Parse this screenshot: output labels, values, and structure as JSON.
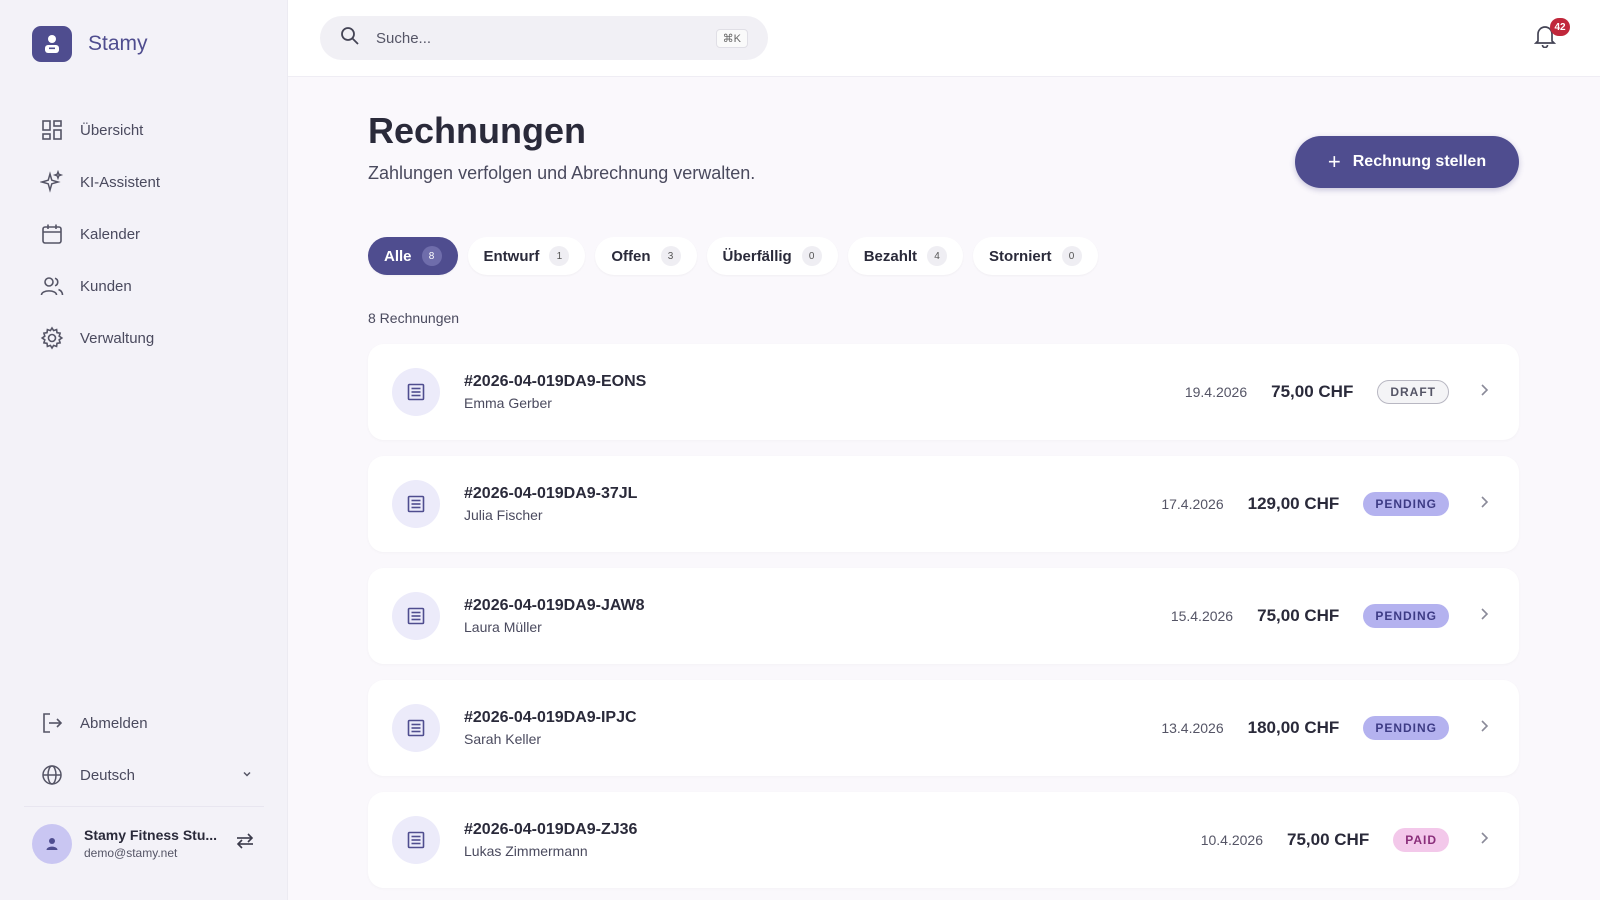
{
  "app": {
    "name": "Stamy"
  },
  "sidebar": {
    "items": [
      {
        "label": "Übersicht",
        "icon": "dashboard-icon"
      },
      {
        "label": "KI-Assistent",
        "icon": "sparkles-icon"
      },
      {
        "label": "Kalender",
        "icon": "calendar-icon"
      },
      {
        "label": "Kunden",
        "icon": "users-icon"
      },
      {
        "label": "Verwaltung",
        "icon": "gear-icon"
      }
    ],
    "logout_label": "Abmelden",
    "language_label": "Deutsch",
    "user": {
      "name": "Stamy Fitness Stu...",
      "email": "demo@stamy.net"
    }
  },
  "topbar": {
    "search_placeholder": "Suche...",
    "shortcut": "⌘K",
    "notification_count": "42"
  },
  "page": {
    "title": "Rechnungen",
    "subtitle": "Zahlungen verfolgen und Abrechnung verwalten.",
    "primary_button": "Rechnung stellen",
    "count_text": "8 Rechnungen"
  },
  "tabs": [
    {
      "label": "Alle",
      "count": "8",
      "active": true
    },
    {
      "label": "Entwurf",
      "count": "1"
    },
    {
      "label": "Offen",
      "count": "3"
    },
    {
      "label": "Überfällig",
      "count": "0"
    },
    {
      "label": "Bezahlt",
      "count": "4"
    },
    {
      "label": "Storniert",
      "count": "0"
    }
  ],
  "invoices": [
    {
      "id": "#2026-04-019DA9-EONS",
      "customer": "Emma Gerber",
      "date": "19.4.2026",
      "amount": "75,00 CHF",
      "status": "DRAFT"
    },
    {
      "id": "#2026-04-019DA9-37JL",
      "customer": "Julia Fischer",
      "date": "17.4.2026",
      "amount": "129,00 CHF",
      "status": "PENDING"
    },
    {
      "id": "#2026-04-019DA9-JAW8",
      "customer": "Laura Müller",
      "date": "15.4.2026",
      "amount": "75,00 CHF",
      "status": "PENDING"
    },
    {
      "id": "#2026-04-019DA9-IPJC",
      "customer": "Sarah Keller",
      "date": "13.4.2026",
      "amount": "180,00 CHF",
      "status": "PENDING"
    },
    {
      "id": "#2026-04-019DA9-ZJ36",
      "customer": "Lukas Zimmermann",
      "date": "10.4.2026",
      "amount": "75,00 CHF",
      "status": "PAID"
    }
  ],
  "colors": {
    "brand": "#4f4d8f",
    "pending_badge": "#b4b2ef",
    "paid_badge": "#f3c8ea",
    "notification_badge": "#c0273b"
  }
}
